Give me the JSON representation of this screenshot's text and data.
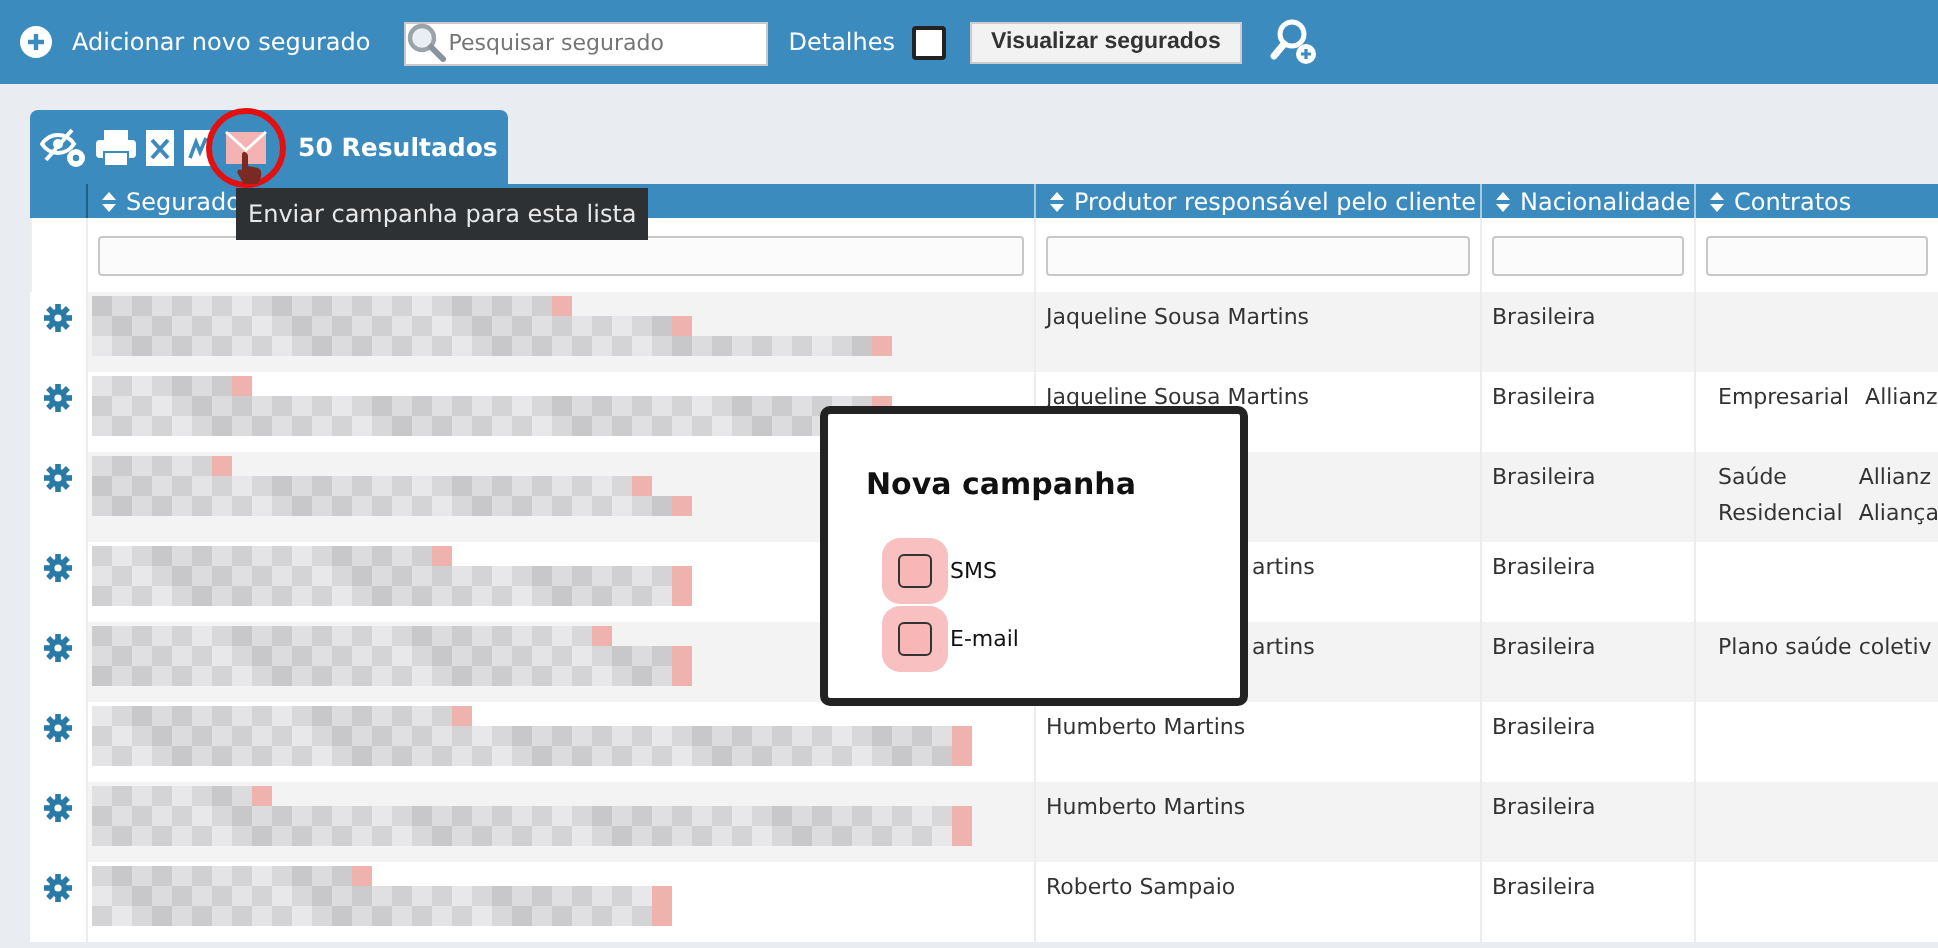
{
  "toolbar": {
    "add_label": "Adicionar novo segurado",
    "search": {
      "placeholder": "Pesquisar segurado"
    },
    "details": {
      "label": "Detalhes",
      "checked": false
    },
    "view_button": "Visualizar segurados"
  },
  "results_tab": {
    "count_label": "50 Resultados",
    "tooltip": "Enviar campanha para esta lista"
  },
  "table": {
    "columns": [
      "Segurado",
      "Produtor responsável pelo cliente",
      "Nacionalidade",
      "Contratos"
    ],
    "rows": [
      {
        "produtor": "Jaqueline Sousa Martins",
        "nacionalidade": "Brasileira",
        "contratos": []
      },
      {
        "produtor": "Jaqueline Sousa Martins",
        "nacionalidade": "Brasileira",
        "contratos": [
          {
            "tipo": "Empresarial",
            "seguradora": "Allianz"
          }
        ]
      },
      {
        "nacionalidade": "Brasileira",
        "contratos": [
          {
            "tipo": "Saúde",
            "seguradora": "Allianz"
          },
          {
            "tipo": "Residencial",
            "seguradora": "Aliança"
          }
        ]
      },
      {
        "produtor": "artins",
        "produtor_cut": true,
        "nacionalidade": "Brasileira",
        "contratos": []
      },
      {
        "produtor": "artins",
        "produtor_cut": true,
        "nacionalidade": "Brasileira",
        "contratos": [
          {
            "tipo": "Plano saúde coletiv"
          }
        ]
      },
      {
        "produtor": "Humberto Martins",
        "nacionalidade": "Brasileira",
        "contratos": []
      },
      {
        "produtor": "Humberto Martins",
        "nacionalidade": "Brasileira",
        "contratos": []
      },
      {
        "produtor": "Roberto Sampaio",
        "nacionalidade": "Brasileira",
        "contratos": []
      }
    ]
  },
  "modal": {
    "title": "Nova campanha",
    "options": [
      {
        "label": "SMS",
        "checked": false
      },
      {
        "label": "E-mail",
        "checked": false
      }
    ]
  }
}
